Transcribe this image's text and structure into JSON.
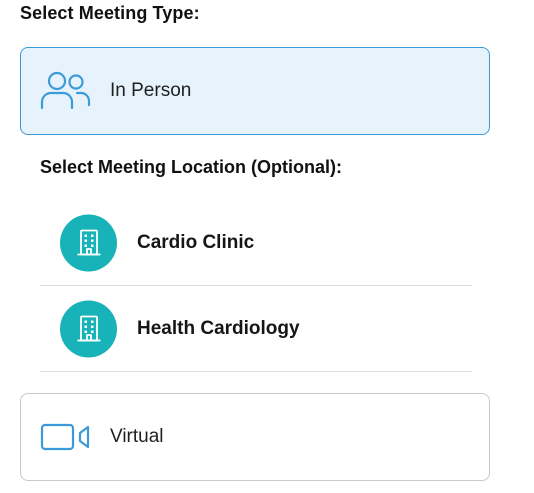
{
  "meeting_type": {
    "heading": "Select Meeting Type:",
    "options": [
      {
        "label": "In Person",
        "icon": "people-icon",
        "selected": true
      },
      {
        "label": "Virtual",
        "icon": "video-camera-icon",
        "selected": false
      }
    ]
  },
  "location": {
    "heading": "Select Meeting Location (Optional):",
    "items": [
      {
        "name": "Cardio Clinic",
        "icon": "building-icon"
      },
      {
        "name": "Health Cardiology",
        "icon": "building-icon"
      }
    ]
  },
  "colors": {
    "selected_bg": "#e6f3fc",
    "selected_border": "#3d9ad8",
    "icon_blue": "#3d9ad8",
    "teal": "#17b3b8"
  }
}
